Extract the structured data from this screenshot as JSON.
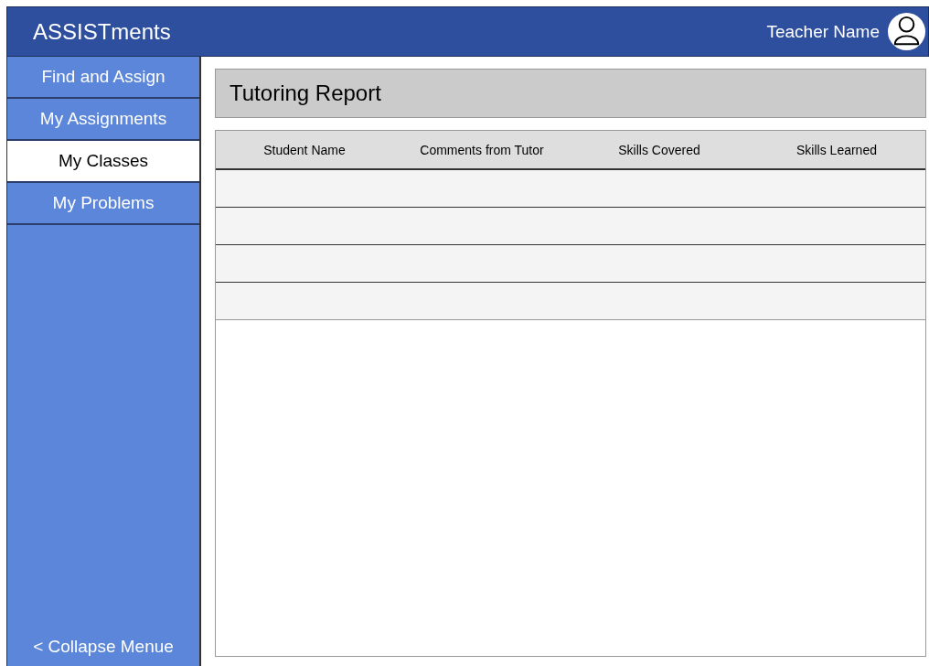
{
  "header": {
    "logo": "ASSISTments",
    "user_name": "Teacher Name"
  },
  "sidebar": {
    "items": [
      {
        "label": "Find and Assign",
        "selected": false
      },
      {
        "label": "My Assignments",
        "selected": false
      },
      {
        "label": "My Classes",
        "selected": true
      },
      {
        "label": "My Problems",
        "selected": false
      }
    ],
    "collapse": "< Collapse Menue"
  },
  "main": {
    "title": "Tutoring Report",
    "table": {
      "columns": [
        "Student Name",
        "Comments from Tutor",
        "Skills Covered",
        "Skills Learned"
      ]
    }
  }
}
